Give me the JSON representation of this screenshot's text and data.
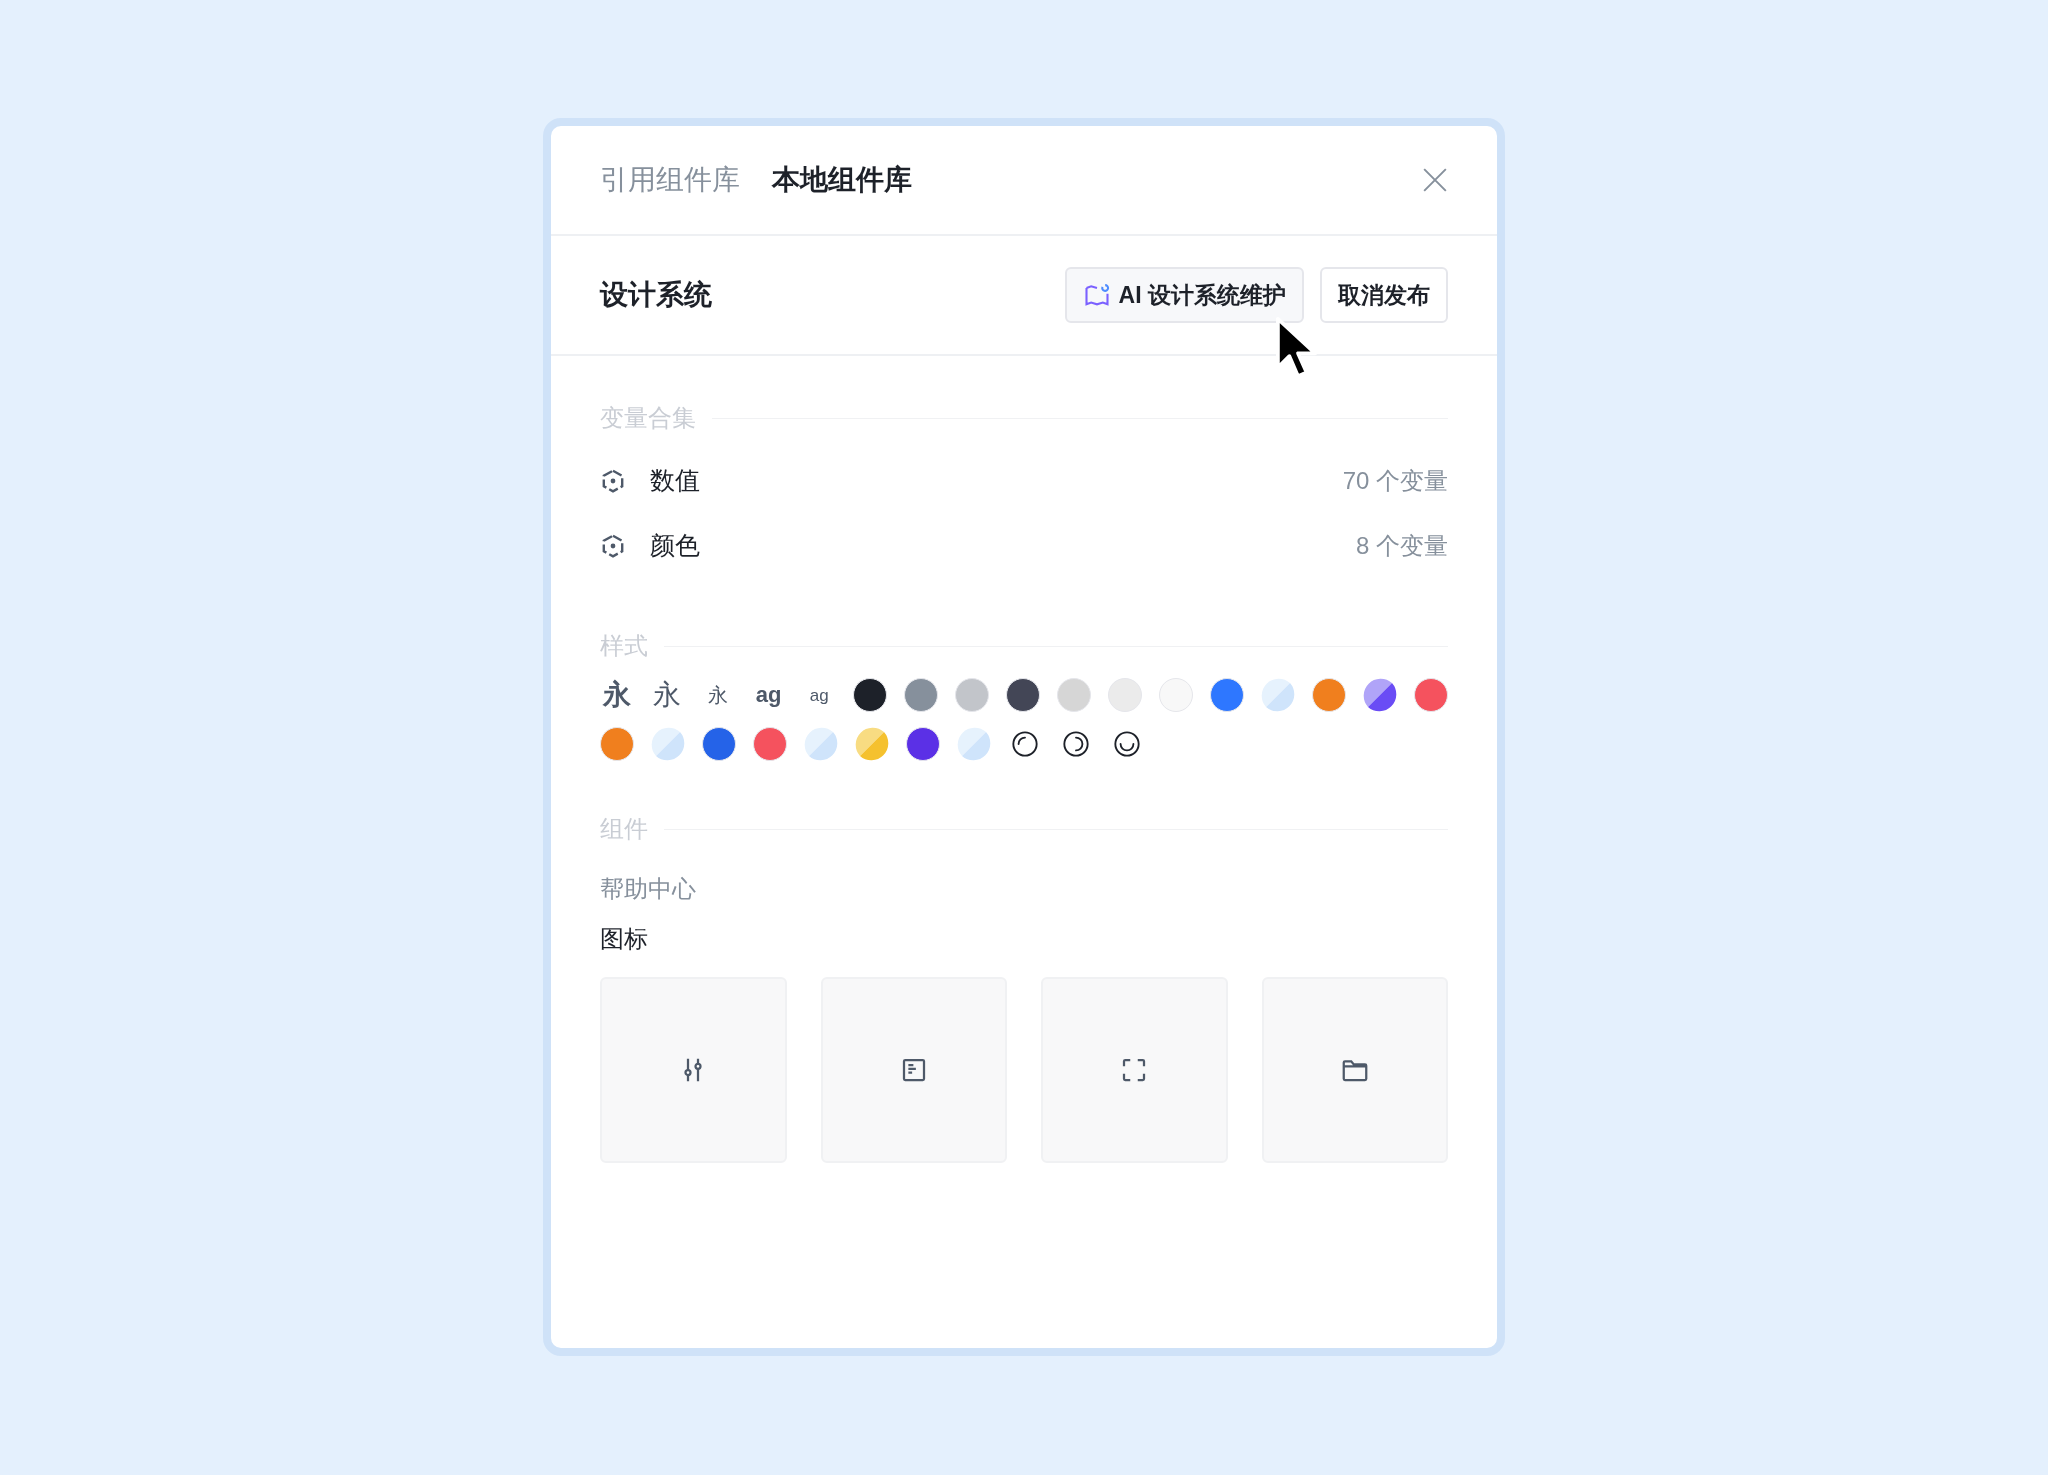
{
  "tabs": [
    {
      "label": "引用组件库",
      "selected": false
    },
    {
      "label": "本地组件库",
      "selected": true
    }
  ],
  "library": {
    "title": "设计系统",
    "buttons": [
      {
        "label": "AI 设计系统维护",
        "kind": "ai"
      },
      {
        "label": "取消发布",
        "kind": "plain"
      }
    ]
  },
  "variable_collections": {
    "heading": "变量合集",
    "items": [
      {
        "name": "数值",
        "count": "70 个变量"
      },
      {
        "name": "颜色",
        "count": "8 个变量"
      }
    ]
  },
  "styles": {
    "heading": "样式",
    "rows": [
      [
        {
          "kind": "heading",
          "label": "永"
        },
        {
          "kind": "title",
          "label": "永"
        },
        {
          "kind": "caption",
          "label": "永"
        },
        {
          "kind": "latin-bold",
          "label": "ag"
        },
        {
          "kind": "latin-small",
          "label": "ag"
        },
        {
          "kind": "color",
          "color": "#1d2129"
        },
        {
          "kind": "color",
          "color": "#86909c"
        },
        {
          "kind": "color",
          "color": "#c2c5ca"
        },
        {
          "kind": "color",
          "color": "#434656"
        },
        {
          "kind": "color",
          "color": "#d6d6d6"
        },
        {
          "kind": "color",
          "color": "#ebebeb"
        },
        {
          "kind": "color",
          "color": "#f8f8f8"
        },
        {
          "kind": "color",
          "color": "#2e77ff"
        },
        {
          "kind": "split",
          "halves": [
            {
              "color": "#e6f2fd"
            },
            {
              "color": "#cfe4fb"
            }
          ]
        },
        {
          "kind": "color",
          "color": "#f07f1e"
        },
        {
          "kind": "split",
          "halves": [
            {
              "color": "#b0a4f8"
            },
            {
              "color": "#6a4cf5"
            }
          ]
        },
        {
          "kind": "color",
          "color": "#f5525e"
        }
      ],
      [
        {
          "kind": "color",
          "color": "#f07f1e"
        },
        {
          "kind": "split",
          "halves": [
            {
              "color": "#e6f2fd"
            },
            {
              "color": "#cfe4fb"
            }
          ]
        },
        {
          "kind": "color",
          "color": "#2563e8"
        },
        {
          "kind": "color",
          "color": "#f5525e"
        },
        {
          "kind": "split",
          "halves": [
            {
              "color": "#e6f2fd"
            },
            {
              "color": "#cfe4fb"
            }
          ]
        },
        {
          "kind": "split",
          "halves": [
            {
              "color": "#f8dc82"
            },
            {
              "color": "#f5c12e"
            }
          ]
        },
        {
          "kind": "color",
          "color": "#5b30e6"
        },
        {
          "kind": "split",
          "halves": [
            {
              "color": "#e6f2fd"
            },
            {
              "color": "#cfe4fb"
            }
          ]
        },
        {
          "kind": "shadow-top"
        },
        {
          "kind": "shadow-right"
        },
        {
          "kind": "shadow-bottom"
        }
      ]
    ]
  },
  "components": {
    "heading": "组件",
    "groups": [
      {
        "label": "帮助中心",
        "selected": false
      },
      {
        "label": "图标",
        "selected": true
      }
    ],
    "icons": [
      {
        "kind": "sliders"
      },
      {
        "kind": "panel"
      },
      {
        "kind": "frame"
      },
      {
        "kind": "folder"
      }
    ]
  }
}
